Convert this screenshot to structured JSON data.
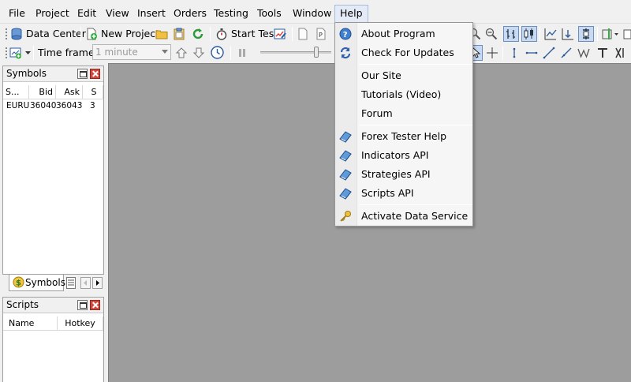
{
  "menubar": {
    "items": [
      {
        "label": "File"
      },
      {
        "label": "Project"
      },
      {
        "label": "Edit"
      },
      {
        "label": "View"
      },
      {
        "label": "Insert"
      },
      {
        "label": "Orders"
      },
      {
        "label": "Testing"
      },
      {
        "label": "Tools"
      },
      {
        "label": "Window"
      },
      {
        "label": "Help"
      }
    ]
  },
  "toolbar": {
    "data_center_label": "Data Center",
    "new_project_label": "New Project",
    "start_test_label": "Start Test",
    "time_frame_label": "Time frame:",
    "time_frame_value": "1 minute"
  },
  "symbols_panel": {
    "title": "Symbols",
    "columns": [
      "S...",
      "Bid",
      "Ask",
      "S"
    ],
    "rows": [
      {
        "symbol": "EURU:",
        "bid": "36040",
        "ask": "36043",
        "spread": "3"
      }
    ],
    "tab_label": "Symbols"
  },
  "scripts_panel": {
    "title": "Scripts",
    "columns": [
      "Name",
      "Hotkey"
    ]
  },
  "help_menu": {
    "items": [
      {
        "label": "About Program",
        "icon": "help-circle-icon"
      },
      {
        "label": "Check For Updates",
        "icon": "refresh-arrows-icon"
      },
      {
        "label": "Our Site",
        "icon": ""
      },
      {
        "label": "Tutorials (Video)",
        "icon": ""
      },
      {
        "label": "Forum",
        "icon": ""
      },
      {
        "label": "Forex Tester Help",
        "icon": "book-icon"
      },
      {
        "label": "Indicators API",
        "icon": "book-icon"
      },
      {
        "label": "Strategies API",
        "icon": "book-icon"
      },
      {
        "label": "Scripts API",
        "icon": "book-icon"
      },
      {
        "label": "Activate Data Service",
        "icon": "key-icon"
      }
    ]
  },
  "colors": {
    "chart_background": "#9d9d9d",
    "menu_highlight": "#e4ebf6",
    "close_button": "#d34a3c"
  }
}
